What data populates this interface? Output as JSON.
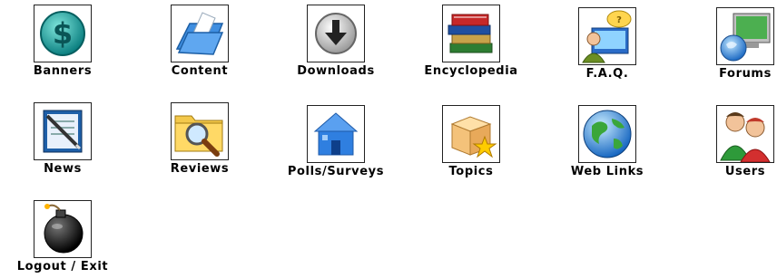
{
  "modules": {
    "banners": {
      "label": "Banners",
      "icon": "dollar-coin-icon"
    },
    "content": {
      "label": "Content",
      "icon": "folder-documents-icon"
    },
    "downloads": {
      "label": "Downloads",
      "icon": "download-arrow-icon"
    },
    "encyclopedia": {
      "label": "Encyclopedia",
      "icon": "books-stack-icon"
    },
    "faq": {
      "label": "F.A.Q.",
      "icon": "faq-person-speech-icon"
    },
    "forums": {
      "label": "Forums",
      "icon": "globe-monitor-icon"
    },
    "news": {
      "label": "News",
      "icon": "newspaper-pen-icon"
    },
    "reviews": {
      "label": "Reviews",
      "icon": "folder-magnifier-icon"
    },
    "polls": {
      "label": "Polls/Surveys",
      "icon": "blue-house-icon"
    },
    "topics": {
      "label": "Topics",
      "icon": "box-star-icon"
    },
    "weblinks": {
      "label": "Web Links",
      "icon": "globe-icon"
    },
    "users": {
      "label": "Users",
      "icon": "users-icon"
    },
    "logout": {
      "label": "Logout / Exit",
      "icon": "bomb-icon"
    }
  }
}
